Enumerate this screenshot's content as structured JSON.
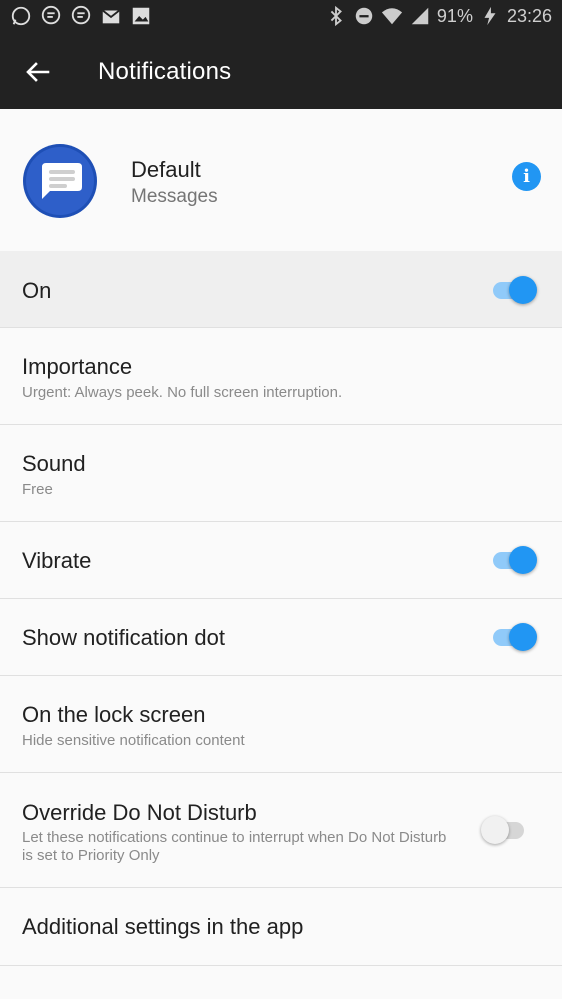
{
  "status_bar": {
    "battery": "91%",
    "time": "23:26",
    "left_icons": [
      "whatsapp-icon",
      "chat-icon",
      "chat-icon",
      "mail-icon",
      "image-icon"
    ],
    "right_icons": [
      "bluetooth-icon",
      "dnd-icon",
      "wifi-icon",
      "signal-icon",
      "battery-charging-icon"
    ]
  },
  "app_bar": {
    "title": "Notifications"
  },
  "header": {
    "title": "Default",
    "subtitle": "Messages"
  },
  "rows": {
    "on": {
      "label": "On",
      "toggle": true
    },
    "importance": {
      "label": "Importance",
      "sub": "Urgent: Always peek. No full screen interruption."
    },
    "sound": {
      "label": "Sound",
      "sub": "Free"
    },
    "vibrate": {
      "label": "Vibrate",
      "toggle": true
    },
    "dot": {
      "label": "Show notification dot",
      "toggle": true
    },
    "lock": {
      "label": "On the lock screen",
      "sub": "Hide sensitive notification content"
    },
    "dnd": {
      "label": "Override Do Not Disturb",
      "sub1": "Let these notifications continue to interrupt when Do Not Disturb",
      "sub2": "is set to Priority Only",
      "toggle": false
    },
    "additional": {
      "label": "Additional settings in the app"
    }
  },
  "colors": {
    "accent": "#2196f3",
    "appbar": "#222222",
    "background": "#fafafa"
  }
}
